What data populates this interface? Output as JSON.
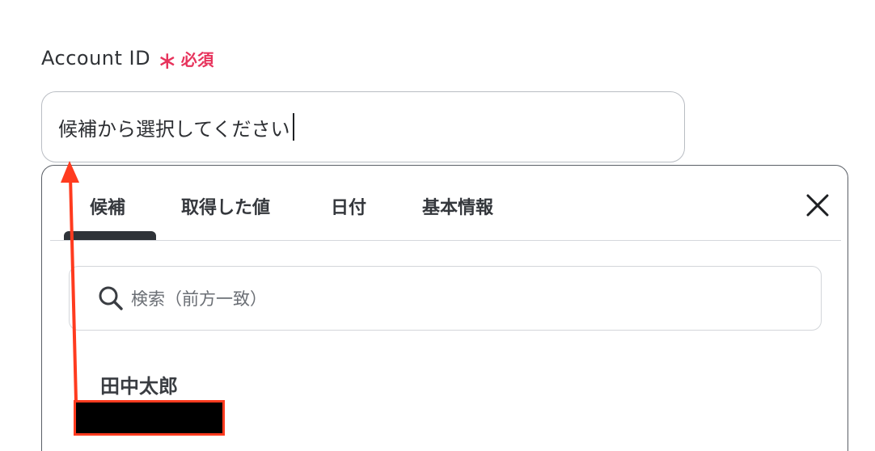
{
  "field": {
    "label": "Account ID",
    "required_mark": "∗",
    "required_text": "必須",
    "value": "候補から選択してください"
  },
  "dropdown": {
    "tabs": [
      {
        "label": "候補",
        "active": true
      },
      {
        "label": "取得した値",
        "active": false
      },
      {
        "label": "日付",
        "active": false
      },
      {
        "label": "基本情報",
        "active": false
      }
    ],
    "close_icon": "close-icon",
    "search": {
      "icon": "search-icon",
      "placeholder": "検索（前方一致）"
    },
    "items": [
      {
        "label": "田中太郎"
      }
    ]
  },
  "annotation": {
    "arrow_color": "#ff3b1f",
    "redaction_color": "#000000"
  },
  "colors": {
    "required": "#e7335c",
    "border": "#b9bdc3",
    "active_tab": "#2f3338"
  }
}
